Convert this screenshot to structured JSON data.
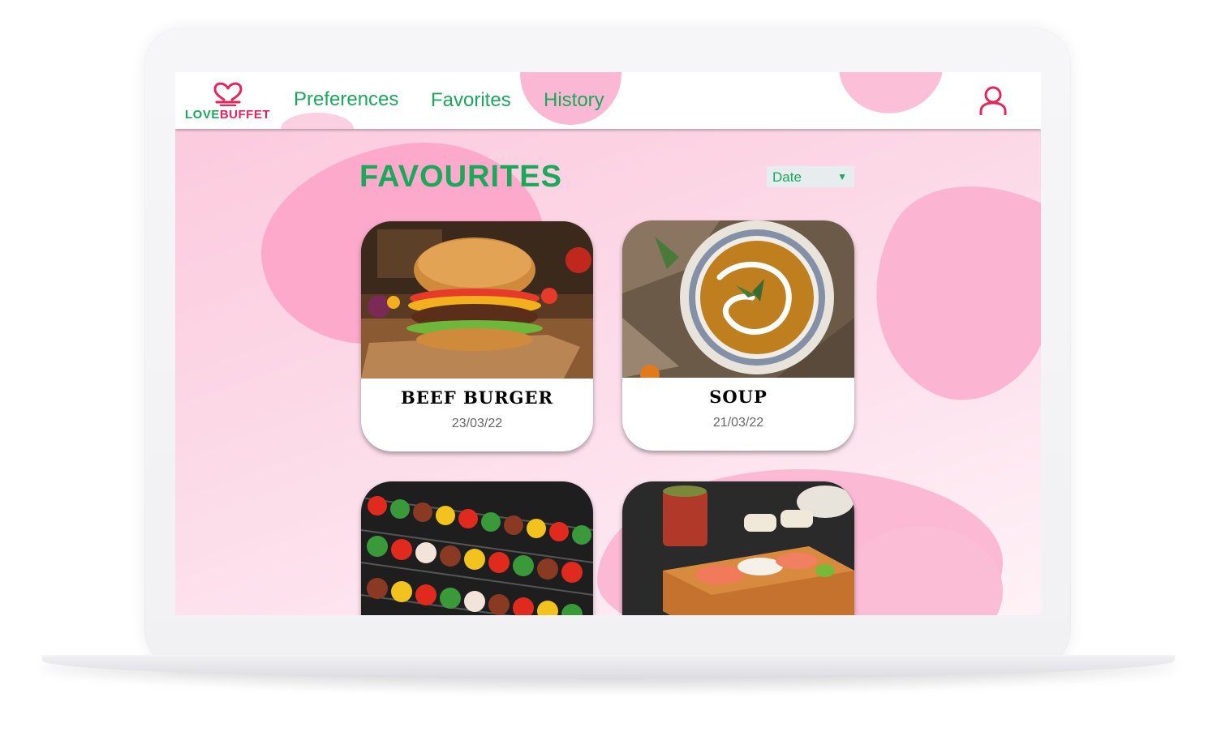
{
  "brand": {
    "part1": "LOVE",
    "part2": "BUFFET",
    "green": "#1aa85b",
    "pink": "#e8245a"
  },
  "nav": {
    "links": [
      {
        "label": "Preferences"
      },
      {
        "label": "Favorites"
      },
      {
        "label": "History"
      }
    ],
    "user_icon": "user-icon"
  },
  "page": {
    "title": "FAVOURITES",
    "sort": {
      "selected": "Date",
      "arrow": "▼"
    }
  },
  "cards": [
    {
      "name": "BEEF BURGER",
      "date": "23/03/22",
      "image": "burger-photo"
    },
    {
      "name": "SOUP",
      "date": "21/03/22",
      "image": "soup-photo"
    },
    {
      "name": "",
      "date": "",
      "image": "kebab-photo"
    },
    {
      "name": "",
      "date": "",
      "image": "sushi-photo"
    }
  ],
  "colors": {
    "accent_green": "#1aa85b",
    "background_pink": "#fcd7e6",
    "blob_pink": "#fca9cc"
  }
}
